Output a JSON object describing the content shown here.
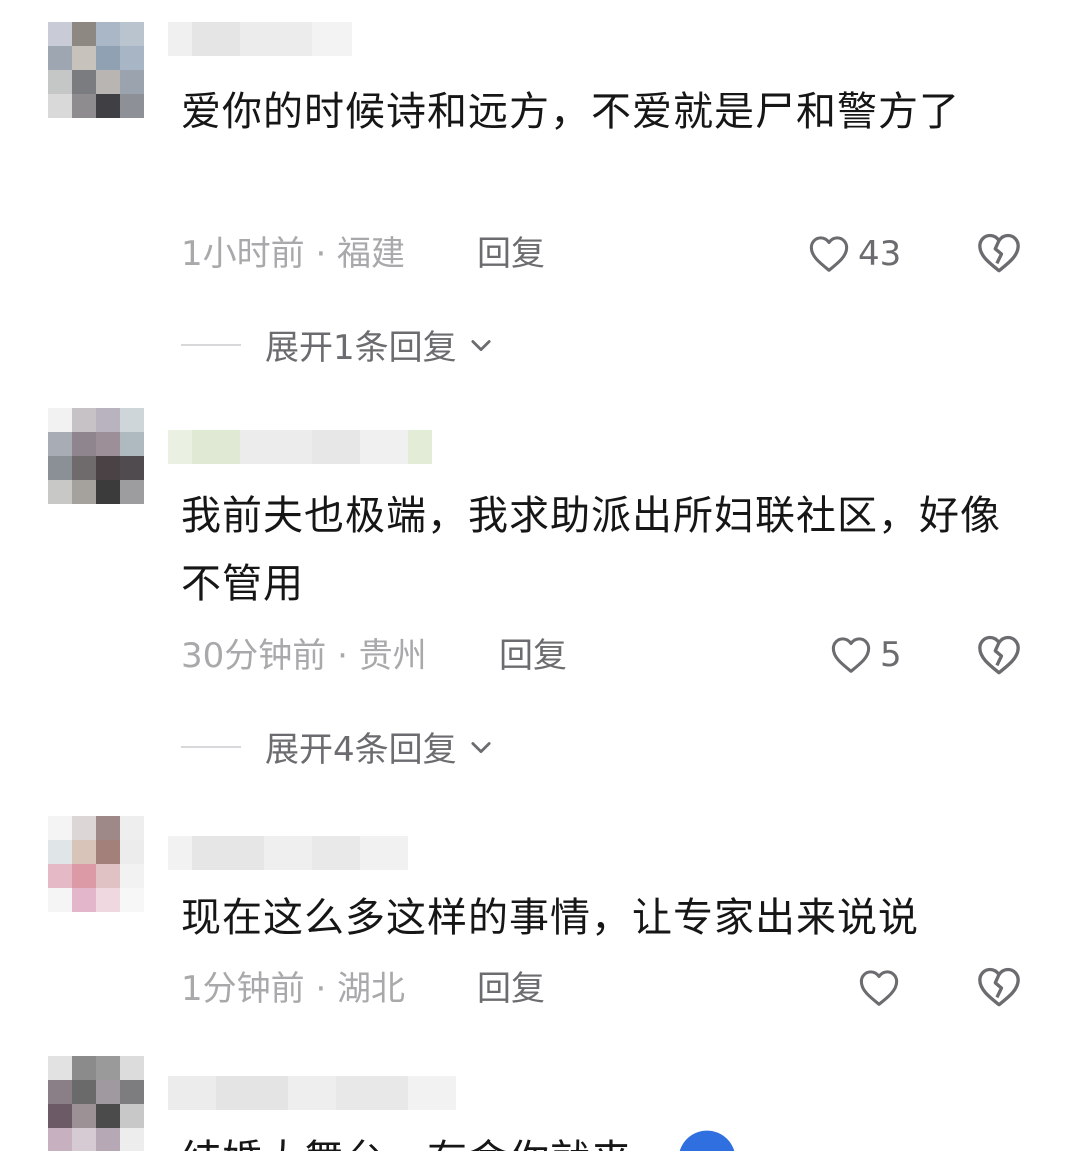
{
  "comments": [
    {
      "text": "爱你的时候诗和远方，不爱就是尸和警方了",
      "time_location": "1小时前 · 福建",
      "reply_label": "回复",
      "likes": "43",
      "expand_label": "展开1条回复"
    },
    {
      "text": "我前夫也极端，我求助派出所妇联社区，好像不管用",
      "time_location": "30分钟前 · 贵州",
      "reply_label": "回复",
      "likes": "5",
      "expand_label": "展开4条回复"
    },
    {
      "text": "现在这么多这样的事情，让专家出来说说",
      "time_location": "1分钟前 · 湖北",
      "reply_label": "回复",
      "likes": ""
    },
    {
      "text": "结婚大舞台，有命你就来"
    }
  ],
  "icons": {
    "like": "heart-outline-icon",
    "dislike": "broken-heart-icon",
    "expand": "chevron-down-icon"
  },
  "colors": {
    "text": "#161616",
    "meta": "#a9a9ab",
    "action": "#6c6c70",
    "divider": "#d8d8da"
  }
}
